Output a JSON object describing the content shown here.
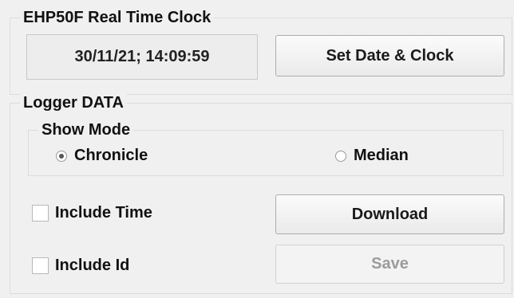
{
  "rtc": {
    "group_title": "EHP50F Real Time Clock",
    "clock_value": "30/11/21; 14:09:59",
    "set_button": "Set Date & Clock"
  },
  "logger": {
    "group_title": "Logger DATA",
    "show_mode": {
      "title": "Show Mode",
      "options": [
        {
          "label": "Chronicle",
          "checked": true
        },
        {
          "label": "Median",
          "checked": false
        }
      ]
    },
    "include_time": {
      "label": "Include Time",
      "checked": false
    },
    "include_id": {
      "label": "Include Id",
      "checked": false
    },
    "download_button": "Download",
    "save_button": "Save",
    "save_enabled": false
  }
}
